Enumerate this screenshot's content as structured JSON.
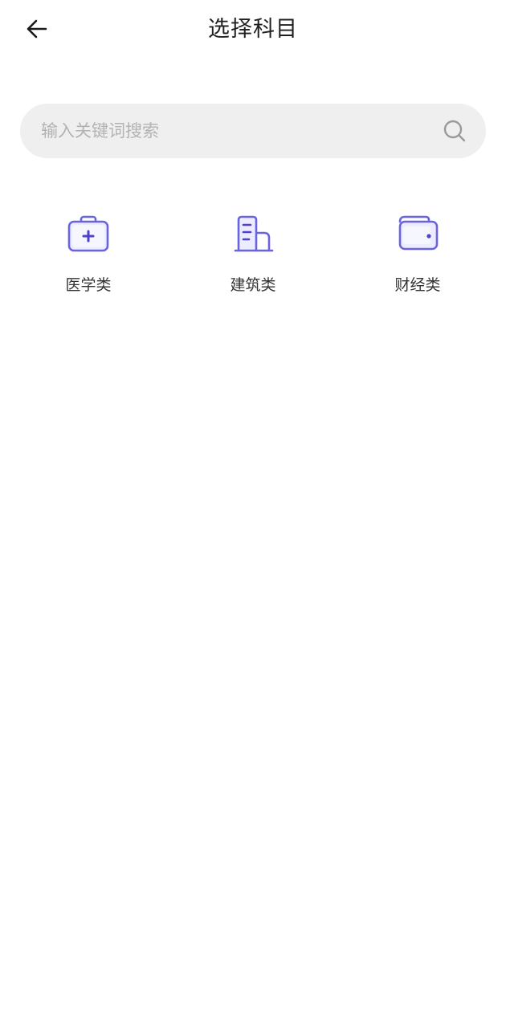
{
  "header": {
    "title": "选择科目",
    "back_icon": "arrow-left-icon"
  },
  "search": {
    "placeholder": "输入关键词搜索",
    "value": "",
    "icon": "search-icon"
  },
  "categories": [
    {
      "label": "医学类",
      "icon": "medical-kit-icon"
    },
    {
      "label": "建筑类",
      "icon": "building-icon"
    },
    {
      "label": "财经类",
      "icon": "wallet-icon"
    }
  ],
  "colors": {
    "icon_accent": "#6a63e0",
    "icon_fill": "#ecebff",
    "search_bg": "#efefef",
    "placeholder": "#b3b3b3"
  }
}
